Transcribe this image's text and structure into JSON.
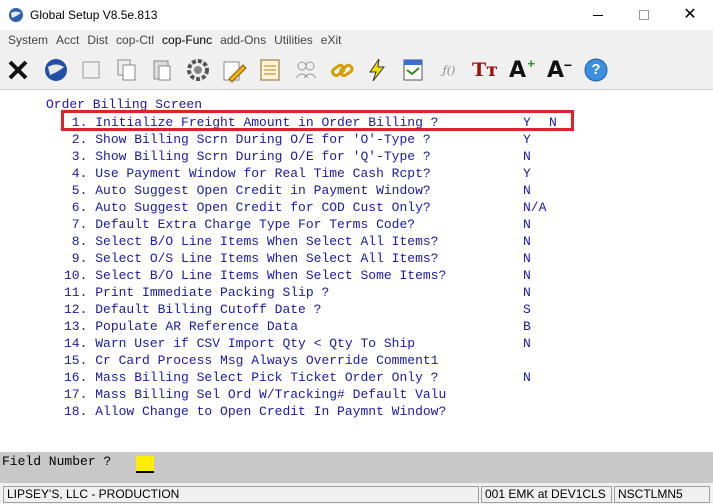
{
  "window": {
    "title": "Global Setup V8.5e.813"
  },
  "menu": [
    {
      "label": "System"
    },
    {
      "label": "Acct"
    },
    {
      "label": "Dist"
    },
    {
      "label": "cop-Ctl"
    },
    {
      "label": "cop-Func"
    },
    {
      "label": "add-Ons"
    },
    {
      "label": "Utilities"
    },
    {
      "label": "eXit"
    }
  ],
  "toolbar": {
    "icons": [
      "close-x-icon",
      "globe-icon",
      "blank-icon",
      "copy-icon",
      "paste-icon",
      "gear-icon",
      "edit-pencil-icon",
      "notepad-icon",
      "users-icon",
      "chain-link-icon",
      "lightning-icon",
      "report-icon",
      "function-icon",
      "text-font-icon",
      "font-increase-icon",
      "font-decrease-icon",
      "help-icon"
    ],
    "font_increase_glyph": "A",
    "font_decrease_glyph": "A",
    "text_font_glyph": "Tт",
    "function_glyph": "ƒ()",
    "help_glyph": "?"
  },
  "screen": {
    "title": "Order Billing Screen",
    "options": [
      {
        "num": " 1.",
        "label": "Initialize Freight Amount in Order Billing ?",
        "value": "Y",
        "value2": "N"
      },
      {
        "num": " 2.",
        "label": "Show Billing Scrn During O/E for 'O'-Type ?",
        "value": "Y",
        "value2": ""
      },
      {
        "num": " 3.",
        "label": "Show Billing Scrn During O/E for 'Q'-Type ?",
        "value": "N",
        "value2": ""
      },
      {
        "num": " 4.",
        "label": "Use Payment Window for Real Time Cash Rcpt?",
        "value": "Y",
        "value2": ""
      },
      {
        "num": " 5.",
        "label": "Auto Suggest Open Credit in Payment Window?",
        "value": "N",
        "value2": ""
      },
      {
        "num": " 6.",
        "label": "Auto Suggest Open Credit for COD Cust Only?",
        "value": "N/A",
        "value2": ""
      },
      {
        "num": " 7.",
        "label": "Default Extra Charge Type For Terms Code?",
        "value": "N",
        "value2": ""
      },
      {
        "num": " 8.",
        "label": "Select B/O Line Items When Select All Items?",
        "value": "N",
        "value2": ""
      },
      {
        "num": " 9.",
        "label": "Select O/S Line Items When Select All Items?",
        "value": "N",
        "value2": ""
      },
      {
        "num": "10.",
        "label": "Select B/O Line Items When Select Some Items?",
        "value": "N",
        "value2": ""
      },
      {
        "num": "11.",
        "label": "Print Immediate Packing Slip ?",
        "value": "N",
        "value2": ""
      },
      {
        "num": "12.",
        "label": "Default Billing Cutoff Date ?",
        "value": "S",
        "value2": ""
      },
      {
        "num": "13.",
        "label": "Populate AR Reference Data",
        "value": "B",
        "value2": ""
      },
      {
        "num": "14.",
        "label": "Warn User if CSV Import Qty < Qty To Ship",
        "value": "N",
        "value2": ""
      },
      {
        "num": "15.",
        "label": "Cr Card Process Msg Always Override Comment1",
        "value": "",
        "value2": ""
      },
      {
        "num": "16.",
        "label": "Mass Billing Select Pick Ticket Order Only ?",
        "value": "N",
        "value2": ""
      },
      {
        "num": "17.",
        "label": "Mass Billing Sel Ord W/Tracking# Default Valu",
        "value": "",
        "value2": ""
      },
      {
        "num": "18.",
        "label": "Allow Change to Open Credit In Paymnt Window?",
        "value": "",
        "value2": ""
      }
    ]
  },
  "prompt": {
    "label": "Field Number ?",
    "value": ""
  },
  "status": {
    "company": "LIPSEY'S, LLC - PRODUCTION",
    "session": "001 EMK at DEV1CLS",
    "terminal": "NSCTLMN5"
  },
  "colors": {
    "highlight": "#e0202a",
    "text": "#1a1aa0",
    "input": "#ffee00"
  }
}
